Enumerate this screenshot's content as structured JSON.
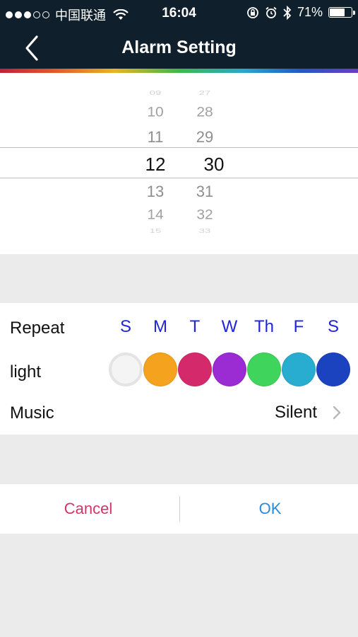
{
  "status_bar": {
    "carrier": "中国联通",
    "time": "16:04",
    "battery_percent": "71%",
    "battery_level": 0.71
  },
  "nav": {
    "title": "Alarm Setting",
    "back_icon": "chevron-left-icon"
  },
  "picker": {
    "hours": [
      "09",
      "10",
      "11",
      "12",
      "13",
      "14",
      "15"
    ],
    "minutes": [
      "27",
      "28",
      "29",
      "30",
      "31",
      "32",
      "33"
    ],
    "selected_hour": "12",
    "selected_minute": "30"
  },
  "settings": {
    "repeat_label": "Repeat",
    "days": [
      "S",
      "M",
      "T",
      "W",
      "Th",
      "F",
      "S"
    ],
    "light_label": "light",
    "light_colors": [
      "#f4f4f4",
      "#f5a21e",
      "#d42a6b",
      "#9b2bd3",
      "#3fd45c",
      "#28add0",
      "#1b43bf"
    ],
    "music_label": "Music",
    "music_value": "Silent"
  },
  "actions": {
    "cancel_label": "Cancel",
    "ok_label": "OK",
    "cancel_color": "#d4346b",
    "ok_color": "#2a8bd9"
  }
}
